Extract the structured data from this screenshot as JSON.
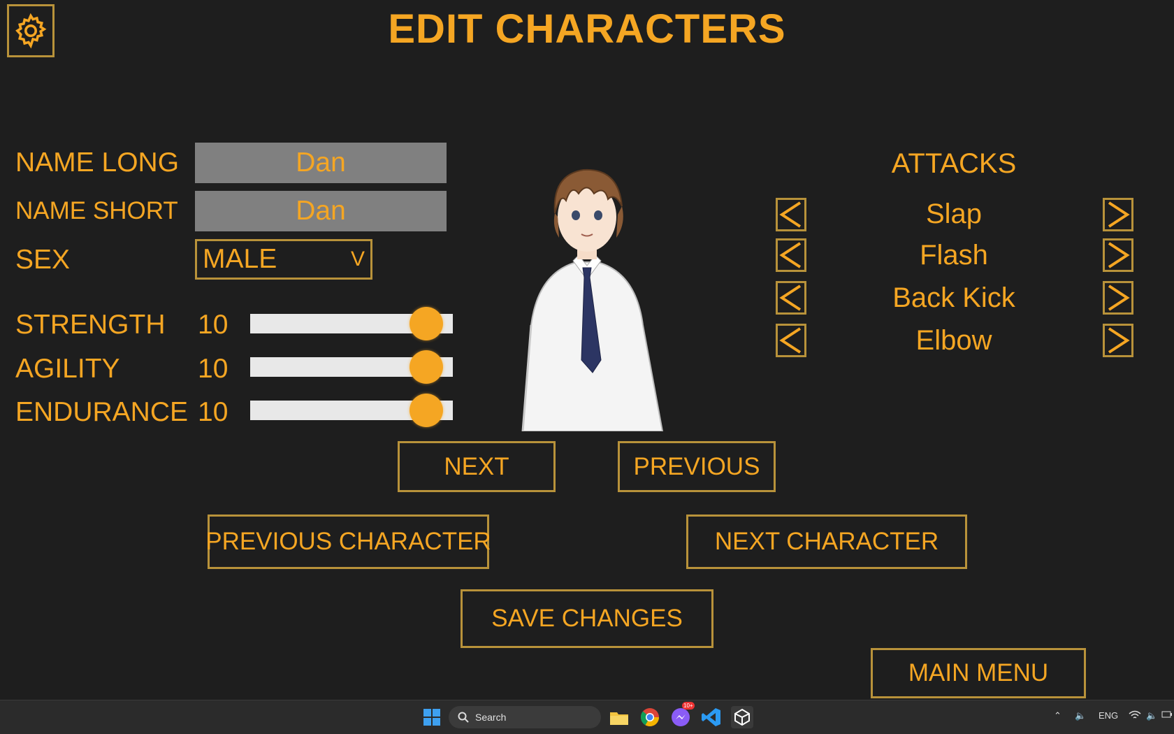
{
  "header": {
    "title": "EDIT CHARACTERS",
    "settings_icon": "gear-icon"
  },
  "form": {
    "name_long_label": "NAME LONG",
    "name_long_value": "Dan",
    "name_short_label": "NAME SHORT",
    "name_short_value": "Dan",
    "sex_label": "SEX",
    "sex_value": "MALE",
    "sex_arrow": "V"
  },
  "stats": [
    {
      "label": "STRENGTH",
      "value": "10",
      "level": 0.87
    },
    {
      "label": "AGILITY",
      "value": "10",
      "level": 0.87
    },
    {
      "label": "ENDURANCE",
      "value": "10",
      "level": 0.87
    }
  ],
  "attacks": {
    "title": "ATTACKS",
    "items": [
      "Slap",
      "Flash",
      "Back Kick",
      "Elbow"
    ]
  },
  "buttons": {
    "next": "NEXT",
    "previous": "PREVIOUS",
    "previous_character": "PREVIOUS CHARACTER",
    "next_character": "NEXT CHARACTER",
    "save_changes": "SAVE CHANGES",
    "main_menu": "MAIN MENU"
  },
  "taskbar": {
    "search_placeholder": "Search",
    "language": "ENG",
    "messenger_badge": "10+",
    "icons": [
      "windows-start-icon",
      "search-icon",
      "file-explorer-icon",
      "chrome-icon",
      "messenger-icon",
      "vscode-icon",
      "unity-icon",
      "chevron-up-icon",
      "speaker-icon",
      "wifi-icon",
      "battery-icon"
    ]
  },
  "colors": {
    "accent": "#f5a623",
    "background": "#1e1e1e",
    "field": "#808080",
    "border": "#b8923a"
  }
}
